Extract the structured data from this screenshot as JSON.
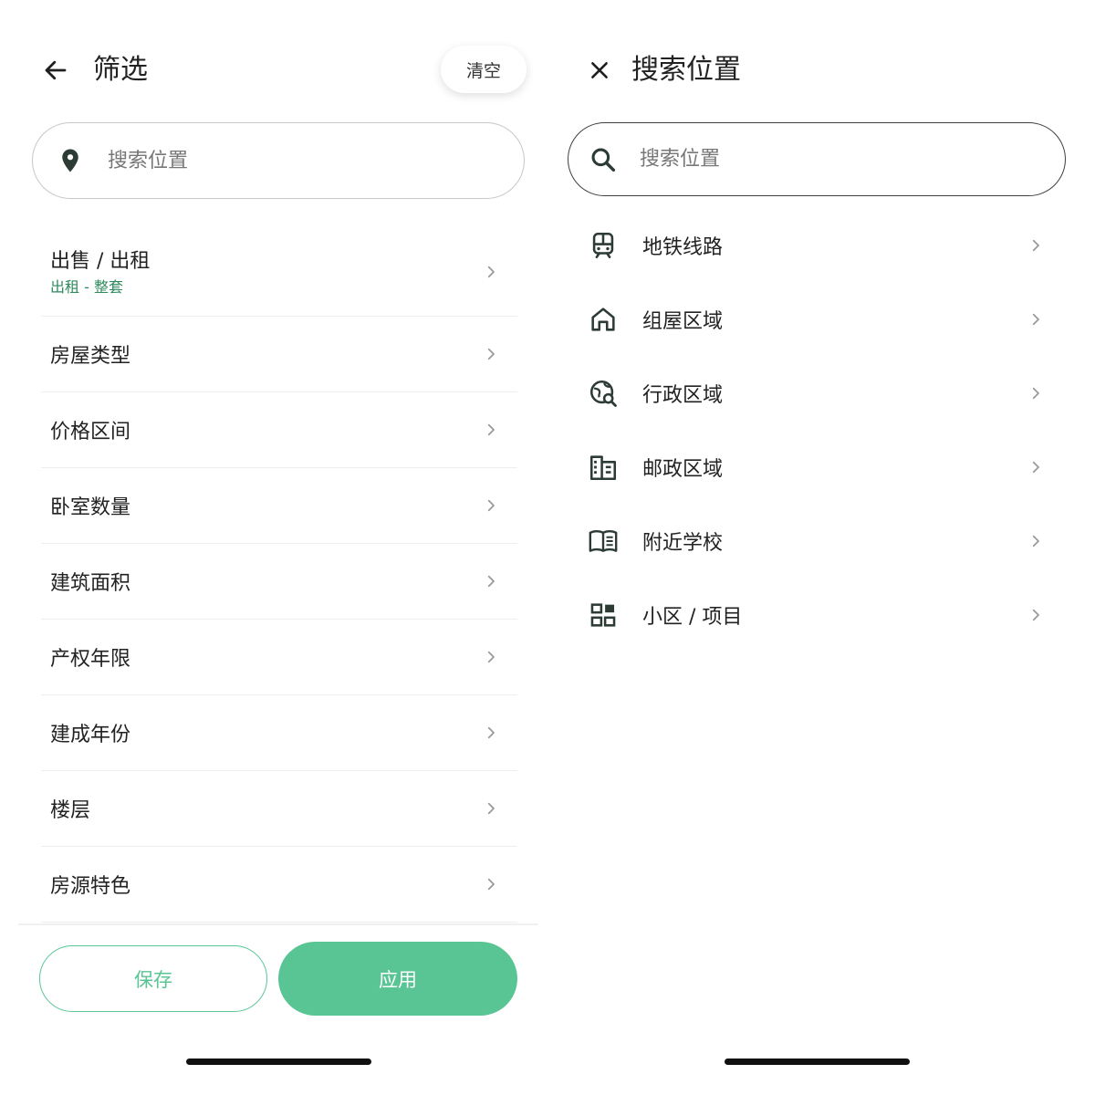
{
  "filter_screen": {
    "title": "筛选",
    "clear_label": "清空",
    "location_search": {
      "placeholder": "搜索位置"
    },
    "rows": [
      {
        "label": "出售 / 出租",
        "value": "出租 - 整套"
      },
      {
        "label": "房屋类型"
      },
      {
        "label": "价格区间"
      },
      {
        "label": "卧室数量"
      },
      {
        "label": "建筑面积"
      },
      {
        "label": "产权年限"
      },
      {
        "label": "建成年份"
      },
      {
        "label": "楼层"
      },
      {
        "label": "房源特色"
      }
    ],
    "save_label": "保存",
    "apply_label": "应用"
  },
  "search_screen": {
    "title": "搜索位置",
    "search": {
      "placeholder": "搜索位置"
    },
    "categories": [
      {
        "label": "地铁线路",
        "icon": "train-icon"
      },
      {
        "label": "组屋区域",
        "icon": "home-icon"
      },
      {
        "label": "行政区域",
        "icon": "globe-search-icon"
      },
      {
        "label": "邮政区域",
        "icon": "building-icon"
      },
      {
        "label": "附近学校",
        "icon": "book-icon"
      },
      {
        "label": "小区 / 项目",
        "icon": "grid-icon"
      }
    ]
  },
  "colors": {
    "accent": "#5ac594",
    "accent_text": "#2f8a5c",
    "icon_dark": "#2d3b35",
    "divider": "#eeeeee"
  }
}
